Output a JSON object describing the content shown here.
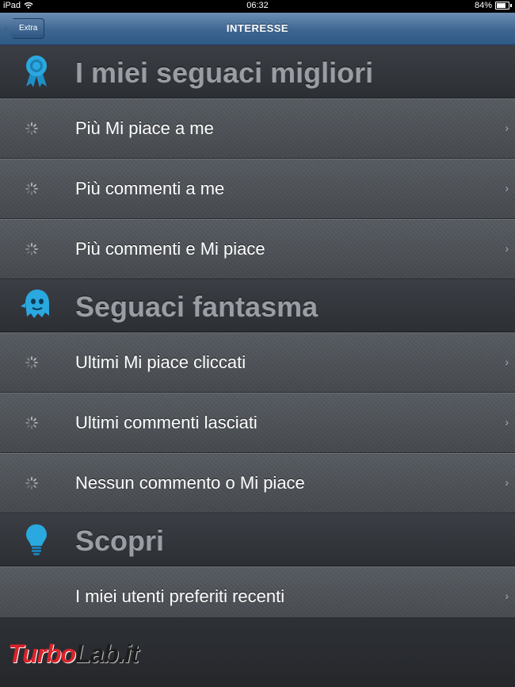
{
  "statusbar": {
    "device": "iPad",
    "time": "06:32",
    "battery": "84%"
  },
  "navbar": {
    "title": "INTERESSE",
    "back_label": "Extra"
  },
  "sections": [
    {
      "title": "I miei seguaci migliori",
      "icon": "ribbon-award-icon",
      "items": [
        "Più Mi piace a me",
        "Più commenti a me",
        "Più commenti e Mi piace"
      ]
    },
    {
      "title": "Seguaci fantasma",
      "icon": "ghost-icon",
      "items": [
        "Ultimi Mi piace cliccati",
        "Ultimi commenti lasciati",
        "Nessun commento o Mi piace"
      ]
    },
    {
      "title": "Scopri",
      "icon": "lightbulb-icon",
      "items": [
        "I miei utenti preferiti recenti"
      ]
    }
  ],
  "watermark": {
    "part1": "Turbo",
    "part2": "Lab.it"
  },
  "colors": {
    "accent": "#2aa8e0",
    "navbar": "#3d6590",
    "row": "#4e5258",
    "header_text": "#9a9ea4"
  }
}
